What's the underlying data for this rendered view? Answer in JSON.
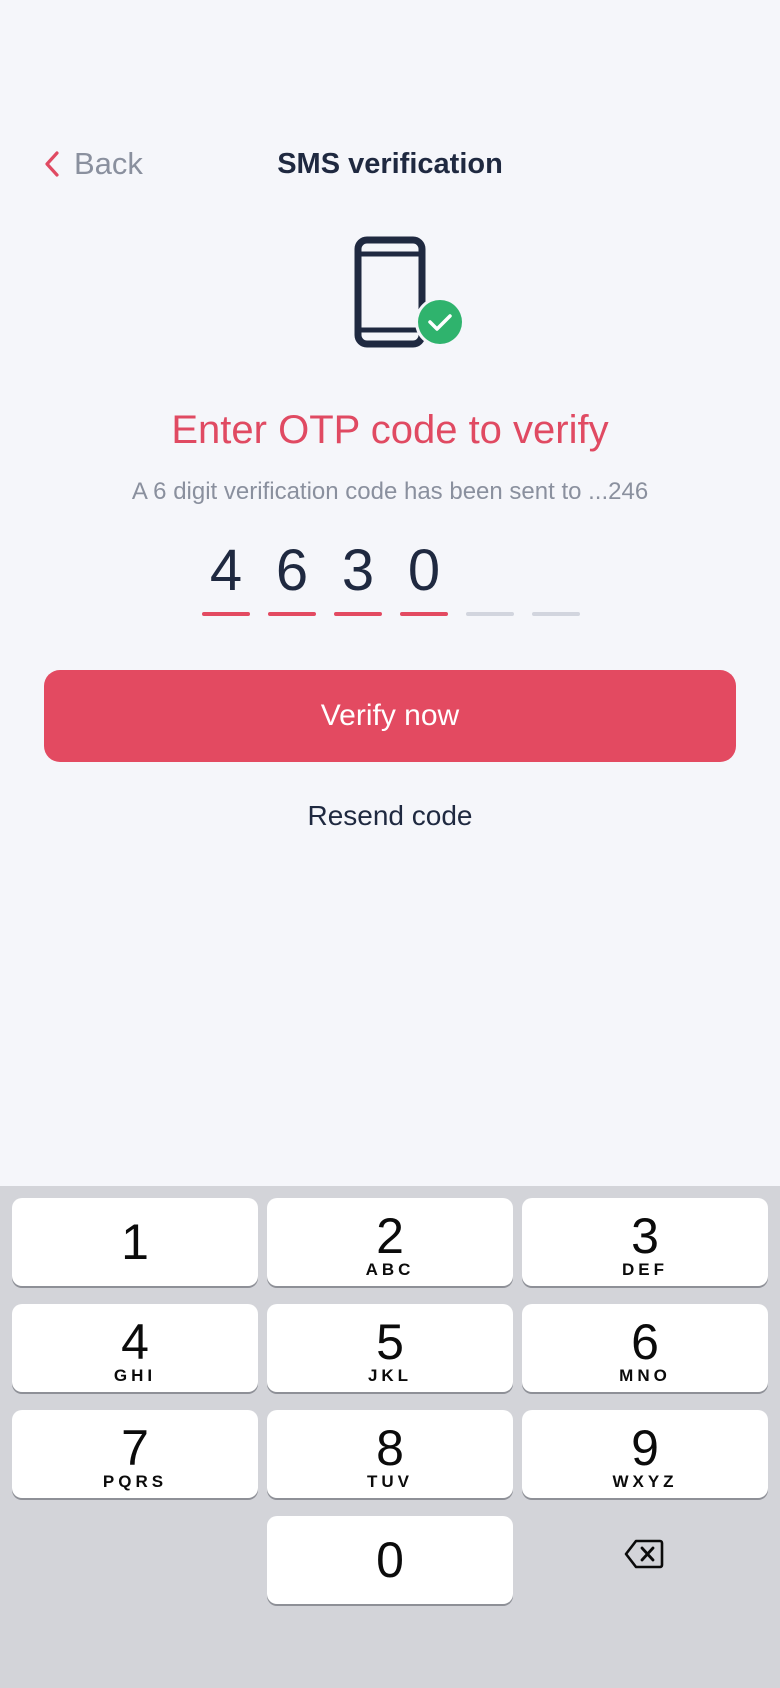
{
  "header": {
    "back_label": "Back",
    "title": "SMS verification",
    "back_icon": "chevron-left-icon"
  },
  "hero": {
    "icon": "phone-check-icon",
    "heading": "Enter OTP code to verify",
    "subtext": "A 6 digit verification code has been sent to ...246"
  },
  "otp": {
    "digits": [
      "4",
      "6",
      "3",
      "0",
      "",
      ""
    ]
  },
  "actions": {
    "verify_label": "Verify now",
    "resend_label": "Resend code"
  },
  "keyboard": {
    "keys": [
      {
        "digit": "1",
        "letters": ""
      },
      {
        "digit": "2",
        "letters": "ABC"
      },
      {
        "digit": "3",
        "letters": "DEF"
      },
      {
        "digit": "4",
        "letters": "GHI"
      },
      {
        "digit": "5",
        "letters": "JKL"
      },
      {
        "digit": "6",
        "letters": "MNO"
      },
      {
        "digit": "7",
        "letters": "PQRS"
      },
      {
        "digit": "8",
        "letters": "TUV"
      },
      {
        "digit": "9",
        "letters": "WXYZ"
      },
      {
        "digit": "0",
        "letters": ""
      }
    ],
    "delete_icon": "backspace-icon"
  },
  "colors": {
    "accent": "#e34a61",
    "text": "#1f2940",
    "muted": "#8a909e",
    "success": "#2fb36d",
    "otp_filled_line": "#e34a61",
    "otp_empty_line": "#d2d5de"
  }
}
